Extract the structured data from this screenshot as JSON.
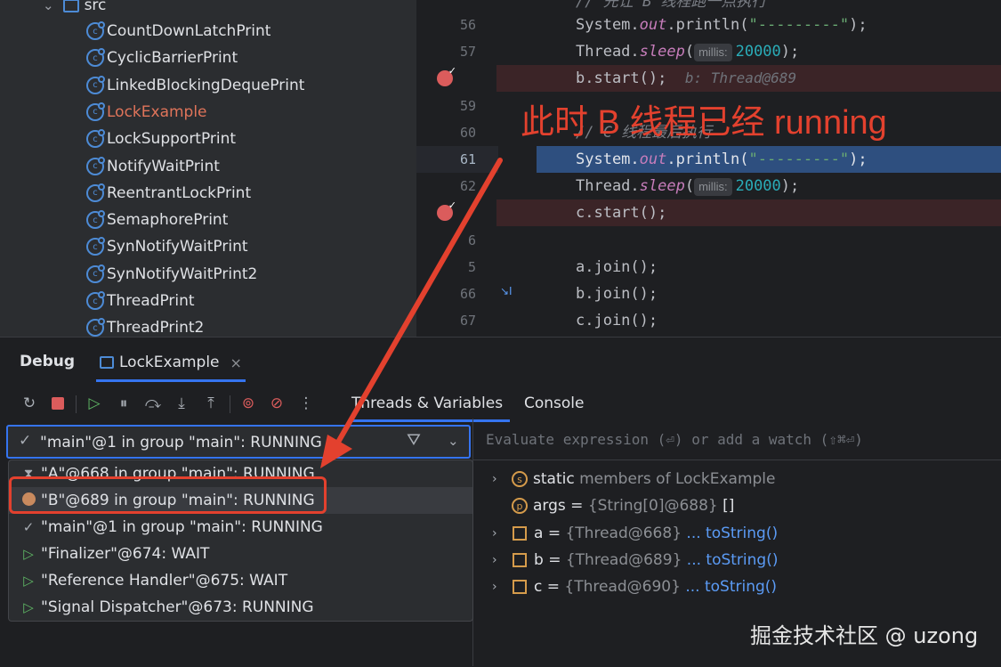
{
  "project_tree": {
    "folder": "src",
    "classes": [
      "CountDownLatchPrint",
      "CyclicBarrierPrint",
      "LinkedBlockingDequePrint",
      "LockExample",
      "LockSupportPrint",
      "NotifyWaitPrint",
      "ReentrantLockPrint",
      "SemaphorePrint",
      "SynNotifyWaitPrint",
      "SynNotifyWaitPrint2",
      "ThreadPrint",
      "ThreadPrint2"
    ],
    "highlighted_class": "LockExample",
    "highlight_color": "#e0745a"
  },
  "editor": {
    "line_numbers": [
      "56",
      "57",
      "",
      "59",
      "60",
      "61",
      "62",
      "",
      "6",
      "5",
      "66",
      "67"
    ],
    "comment_top": "// 先让 B 线程跑一点执行",
    "sysout_obj": "System.",
    "sysout_field": "out",
    "sysout_method": ".println(",
    "sysout_str": "\"---------\"",
    "sysout_end": ");",
    "sleep_obj": "Thread.",
    "sleep_method": "sleep",
    "sleep_open": "(",
    "param_hint": "millis:",
    "sleep_value": "20000",
    "sleep_end": ");",
    "b_start": "b.start();",
    "b_inline_value": "b: Thread@689",
    "comment_c": "// C 线程最后执行",
    "c_start": "c.start();",
    "a_join": "a.join();",
    "b_join": "b.join();",
    "c_join": "c.join();"
  },
  "debug": {
    "title": "Debug",
    "tab_label": "LockExample",
    "close": "×",
    "tab_threads": "Threads & Variables",
    "tab_console": "Console",
    "toolbar": [
      "rerun-icon",
      "stop-icon",
      "resume-icon",
      "pause-icon",
      "step-over-icon",
      "step-into-icon",
      "step-out-icon",
      "view-breakpoints-icon",
      "mute-breakpoints-icon",
      "more-icon"
    ],
    "selected_thread": "\"main\"@1 in group \"main\": RUNNING",
    "threads": [
      {
        "label": "\"A\"@668 in group \"main\": RUNNING",
        "icon": "hourglass-icon"
      },
      {
        "label": "\"B\"@689 in group \"main\": RUNNING",
        "icon": "dot-icon"
      },
      {
        "label": "\"main\"@1 in group \"main\": RUNNING",
        "icon": "check-icon"
      },
      {
        "label": "\"Finalizer\"@674: WAIT",
        "icon": "play-icon"
      },
      {
        "label": "\"Reference Handler\"@675: WAIT",
        "icon": "play-icon"
      },
      {
        "label": "\"Signal Dispatcher\"@673: RUNNING",
        "icon": "play-icon"
      }
    ],
    "eval_placeholder": "Evaluate expression (⏎) or add a watch (⇧⌘⏎)",
    "variables": {
      "static_kw": "static",
      "static_rest": "members of LockExample",
      "args_name": "args",
      "eq": "=",
      "args_val": "{String[0]@688}",
      "args_brackets": "[]",
      "vars": [
        {
          "name": "a",
          "type": "{Thread@668}",
          "action": "... toString()"
        },
        {
          "name": "b",
          "type": "{Thread@689}",
          "action": "... toString()"
        },
        {
          "name": "c",
          "type": "{Thread@690}",
          "action": "... toString()"
        }
      ]
    }
  },
  "annotation": "此时 B 线程已经 running",
  "watermark": "掘金技术社区 @ uzong",
  "colors": {
    "annotation": "#e3412e",
    "selection_blue": "#2e4f7f",
    "breakpoint": "#db5c5c"
  }
}
